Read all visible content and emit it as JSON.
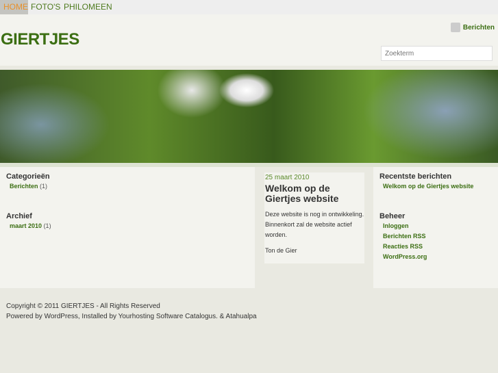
{
  "nav": [
    "HOME",
    "FOTO'S",
    "PHILOMEEN"
  ],
  "site_title": "GIERTJES",
  "rss_label": "Berichten",
  "search_placeholder": "Zoekterm",
  "left": {
    "categories_title": "Categorieën",
    "category": "Berichten",
    "category_count": "(1)",
    "archive_title": "Archief",
    "archive": "maart 2010",
    "archive_count": "(1)"
  },
  "post": {
    "date": "25 maart 2010",
    "title": "Welkom op de Giertjes website",
    "body": "Deze website is nog in ontwikkeling. Binnenkort zal de website actief worden.",
    "author": "Ton de Gier"
  },
  "right": {
    "recent_title": "Recentste berichten",
    "recent": "Welkom op de Giertjes website",
    "admin_title": "Beheer",
    "admin": [
      "Inloggen",
      "Berichten RSS",
      "Reacties RSS",
      "WordPress.org"
    ]
  },
  "footer": {
    "copyright": "Copyright © 2011 GIERTJES - All Rights Reserved",
    "powered": "Powered by WordPress, Installed by Yourhosting Software Catalogus. & Atahualpa"
  }
}
